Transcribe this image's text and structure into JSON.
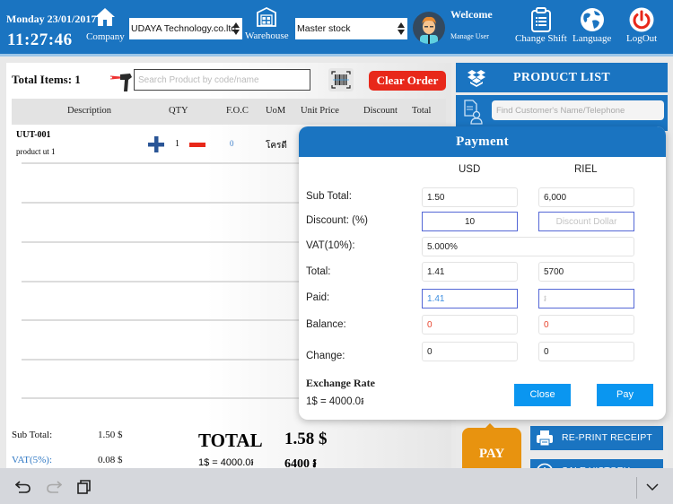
{
  "header": {
    "date": "Monday 23/01/2017",
    "time": "11:27:46",
    "company_label": "Company",
    "company_select": "UDAYA Technology.co.ltd",
    "warehouse_label": "Warehouse",
    "warehouse_select": "Master stock",
    "welcome": "Welcome",
    "manage_user": "Manage User",
    "change_shift": "Change Shift",
    "language": "Language",
    "logout": "LogOut",
    "colors": {
      "bar": "#1a74c1",
      "logout_icon": "#e8281a"
    }
  },
  "order": {
    "total_items": "Total Items: 1",
    "search_placeholder": "Search Product by code/name",
    "clear_order": "Clear Order",
    "columns": [
      "Description",
      "QTY",
      "F.O.C",
      "UoM",
      "Unit Price",
      "Discount",
      "Total"
    ],
    "items": [
      {
        "code": "UUT-001",
        "name": "product ut 1",
        "qty": "1",
        "foc": "0",
        "uom": "โครดี"
      }
    ]
  },
  "summary": {
    "subtotal_label": "Sub Total:",
    "subtotal_value": "1.50 $",
    "vat_label": "VAT(5%):",
    "vat_value": "0.08 $",
    "total_label": "TOTAL",
    "total_value": "1.58 $",
    "rate": "1$ = 4000.0៛",
    "riel_total": "6400 ៛"
  },
  "right_panel": {
    "product_list": "PRODUCT LIST",
    "customer_placeholder": "Find Customer's Name/Telephone",
    "pay": "PAY",
    "reprint": "RE-PRINT RECEIPT",
    "history": "SALE HISTORY"
  },
  "payment": {
    "title": "Payment",
    "col_usd": "USD",
    "col_riel": "RIEL",
    "rows": {
      "subtotal": {
        "label": "Sub Total:",
        "usd": "1.50",
        "riel": "6,000"
      },
      "discount": {
        "label": "Discount: (%)",
        "usd": "10",
        "riel_placeholder": "Discount Dollar"
      },
      "vat": {
        "label": "VAT(10%):",
        "value": "5.000%"
      },
      "total": {
        "label": "Total:",
        "usd": "1.41",
        "riel": "5700"
      },
      "paid": {
        "label": "Paid:",
        "usd": "1.41",
        "riel_placeholder": "៛"
      },
      "balance": {
        "label": "Balance:",
        "usd": "0",
        "riel": "0"
      },
      "change": {
        "label": "Change:",
        "usd": "0",
        "riel": "0"
      }
    },
    "exchange_title": "Exchange Rate",
    "exchange_value": "1$ = 4000.0៛",
    "close": "Close",
    "pay": "Pay"
  }
}
